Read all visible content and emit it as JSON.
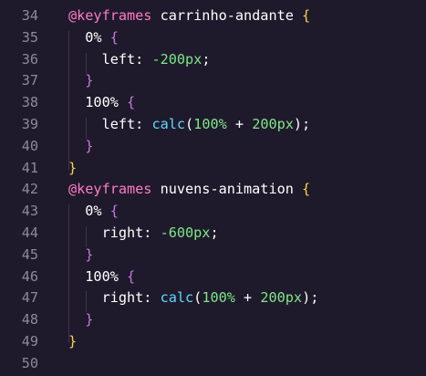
{
  "editor": {
    "lines": [
      {
        "number": "34",
        "tokens": [
          {
            "text": "@keyframes",
            "cls": "kw"
          },
          {
            "text": " carrinho-andante ",
            "cls": "name"
          },
          {
            "text": "{",
            "cls": "brace1"
          }
        ]
      },
      {
        "number": "35",
        "tokens": [
          {
            "text": "  0% ",
            "cls": "pct"
          },
          {
            "text": "{",
            "cls": "brace2"
          }
        ]
      },
      {
        "number": "36",
        "tokens": [
          {
            "text": "    left: ",
            "cls": "prop"
          },
          {
            "text": "-200px",
            "cls": "num"
          },
          {
            "text": ";",
            "cls": "punct"
          }
        ]
      },
      {
        "number": "37",
        "tokens": [
          {
            "text": "  ",
            "cls": "punct"
          },
          {
            "text": "}",
            "cls": "brace2"
          }
        ]
      },
      {
        "number": "38",
        "tokens": [
          {
            "text": "  100% ",
            "cls": "pct"
          },
          {
            "text": "{",
            "cls": "brace2"
          }
        ]
      },
      {
        "number": "39",
        "tokens": [
          {
            "text": "    left: ",
            "cls": "prop"
          },
          {
            "text": "calc",
            "cls": "fn"
          },
          {
            "text": "(",
            "cls": "punct"
          },
          {
            "text": "100%",
            "cls": "num"
          },
          {
            "text": " + ",
            "cls": "punct"
          },
          {
            "text": "200px",
            "cls": "num"
          },
          {
            "text": ");",
            "cls": "punct"
          }
        ]
      },
      {
        "number": "40",
        "tokens": [
          {
            "text": "  ",
            "cls": "punct"
          },
          {
            "text": "}",
            "cls": "brace2"
          }
        ]
      },
      {
        "number": "41",
        "tokens": [
          {
            "text": "}",
            "cls": "brace1"
          }
        ]
      },
      {
        "number": "42",
        "tokens": [
          {
            "text": "@keyframes",
            "cls": "kw"
          },
          {
            "text": " nuvens-animation ",
            "cls": "name"
          },
          {
            "text": "{",
            "cls": "brace1"
          }
        ]
      },
      {
        "number": "43",
        "tokens": [
          {
            "text": "  0% ",
            "cls": "pct"
          },
          {
            "text": "{",
            "cls": "brace2"
          }
        ]
      },
      {
        "number": "44",
        "tokens": [
          {
            "text": "    right: ",
            "cls": "prop"
          },
          {
            "text": "-600px",
            "cls": "num"
          },
          {
            "text": ";",
            "cls": "punct"
          }
        ]
      },
      {
        "number": "45",
        "tokens": [
          {
            "text": "  ",
            "cls": "punct"
          },
          {
            "text": "}",
            "cls": "brace2"
          }
        ]
      },
      {
        "number": "46",
        "tokens": [
          {
            "text": "  100% ",
            "cls": "pct"
          },
          {
            "text": "{",
            "cls": "brace2"
          }
        ]
      },
      {
        "number": "47",
        "tokens": [
          {
            "text": "    right: ",
            "cls": "prop"
          },
          {
            "text": "calc",
            "cls": "fn"
          },
          {
            "text": "(",
            "cls": "punct"
          },
          {
            "text": "100%",
            "cls": "num"
          },
          {
            "text": " + ",
            "cls": "punct"
          },
          {
            "text": "200px",
            "cls": "num"
          },
          {
            "text": ");",
            "cls": "punct"
          }
        ]
      },
      {
        "number": "48",
        "tokens": [
          {
            "text": "  ",
            "cls": "punct"
          },
          {
            "text": "}",
            "cls": "brace2"
          }
        ]
      },
      {
        "number": "49",
        "tokens": [
          {
            "text": "}",
            "cls": "brace1"
          }
        ]
      },
      {
        "number": "50",
        "tokens": []
      }
    ]
  },
  "theme": {
    "background": "#1f1a2b",
    "line_number_color": "#8c8a95",
    "keyword_color": "#ff7ac6",
    "number_color": "#7ee787",
    "function_color": "#5fd7ff",
    "outer_brace_color": "#ffd24a",
    "inner_brace_color": "#c678dd"
  }
}
